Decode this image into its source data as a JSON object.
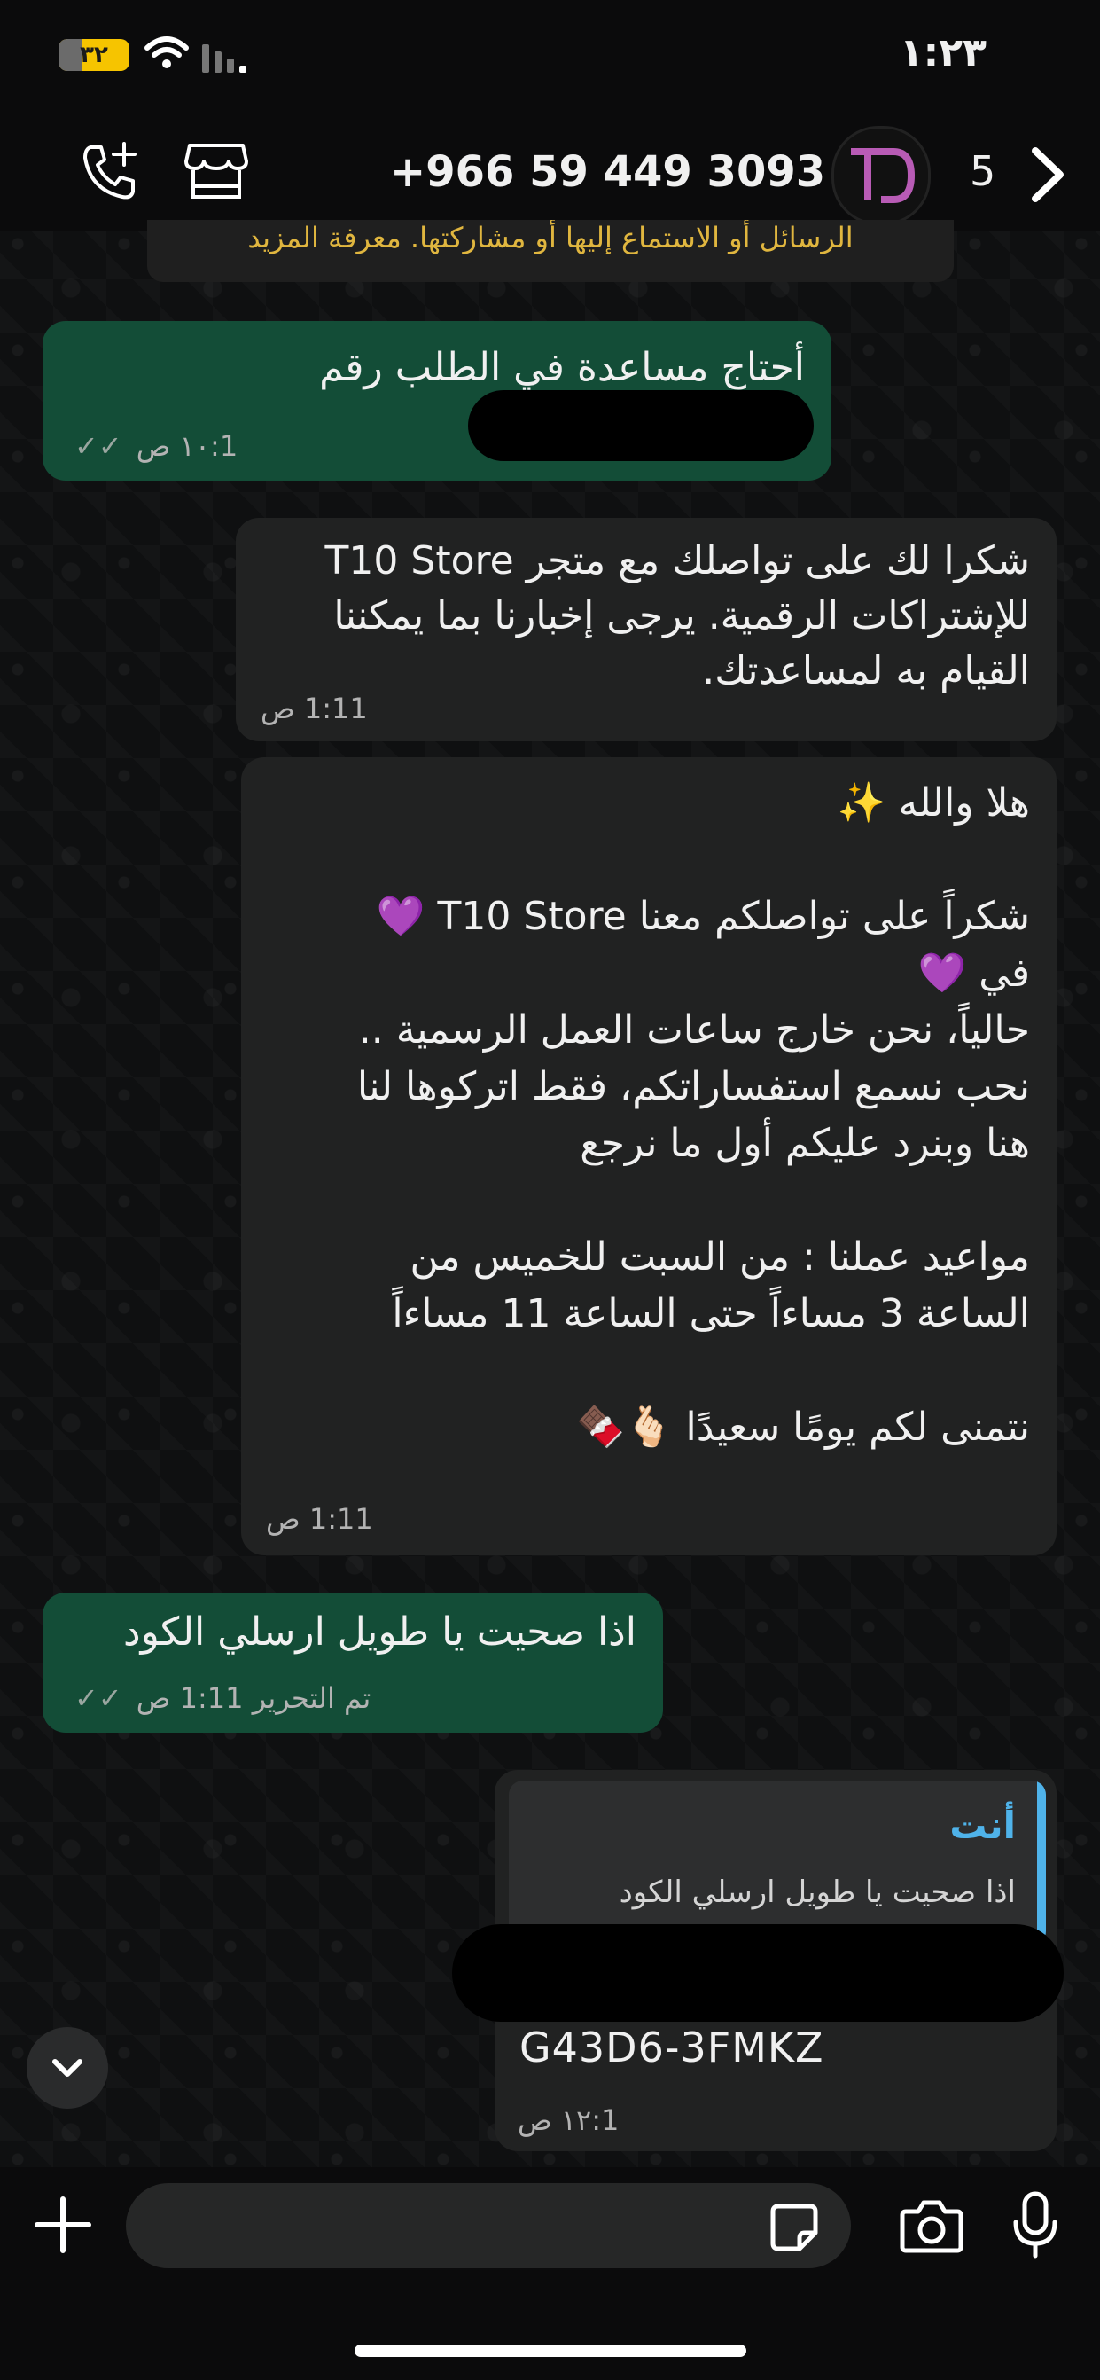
{
  "status_bar": {
    "time": "١:٢٣",
    "battery": "٣٢"
  },
  "header": {
    "contact": "+966 59 449 3093",
    "avatar_text": "TD",
    "unread_count": "5"
  },
  "notice": {
    "text": "الرسائل أو الاستماع إليها أو مشاركتها. معرفة المزيد"
  },
  "messages": [
    {
      "text": "أحتاج مساعدة في الطلب رقم\n#",
      "time": "1:١٠ ص",
      "edited": ""
    },
    {
      "text": "شكرا لك على تواصلك مع متجر T10 Store للإشتراكات الرقمية. يرجى إخبارنا بما يمكننا القيام به لمساعدتك.",
      "time": "1:11 ص"
    },
    {
      "text": "هلا والله ✨\n\nشكراً على تواصلكم معنا T10 Store 💜\nفي 💜\nحالياً، نحن خارج ساعات العمل الرسمية ..\nنحب نسمع استفساراتكم، فقط اتركوها لنا\nهنا وبنرد عليكم أول ما نرجع\n\nمواعيد عملنا : من السبت للخميس من\nالساعة 3 مساءاً حتى الساعة 11 مساءاً\n\nنتمنى لكم يومًا سعيدًا 🫰🏻🍫",
      "time": "1:11 ص"
    },
    {
      "text": "اذا صحيت يا طويل ارسلي الكود",
      "time": "1:11 ص",
      "edited": "تم التحرير"
    },
    {
      "reply_author": "أنت",
      "reply_text": "اذا صحيت يا طويل ارسلي الكود",
      "text": "G43D6-3FMKZ",
      "time": "1:١٢ ص"
    }
  ],
  "input": {
    "placeholder": ""
  },
  "colors": {
    "outgoing": "#134d37",
    "incoming": "#212222",
    "accent": "#4fb3ea",
    "notice": "#e0b63f"
  }
}
